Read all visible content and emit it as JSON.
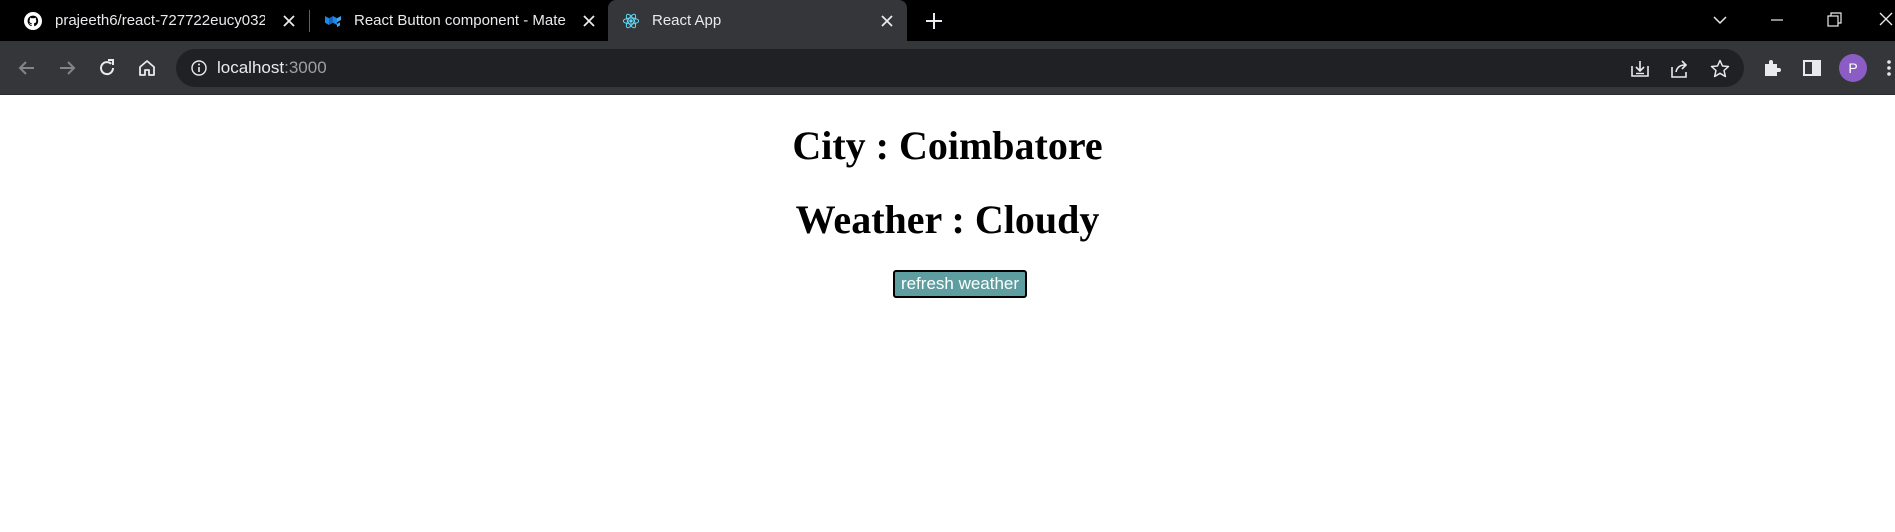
{
  "browser": {
    "tabs": [
      {
        "title": "prajeeth6/react-727722eucy032",
        "favicon": "github-icon",
        "active": false
      },
      {
        "title": "React Button component - Mate",
        "favicon": "mui-icon",
        "active": false
      },
      {
        "title": "React App",
        "favicon": "react-icon",
        "active": true
      }
    ],
    "address": {
      "host": "localhost",
      "port": ":3000"
    },
    "profile_initial": "P",
    "colors": {
      "frame": "#000000",
      "toolbar": "#35363a",
      "omnibox": "#202124",
      "avatar": "#8b5cc4"
    }
  },
  "page": {
    "city_heading": "City : Coimbatore",
    "weather_heading": "Weather : Cloudy",
    "refresh_button_label": "refresh weather",
    "colors": {
      "button_bg": "#5f9ea0",
      "text": "#000000"
    }
  }
}
